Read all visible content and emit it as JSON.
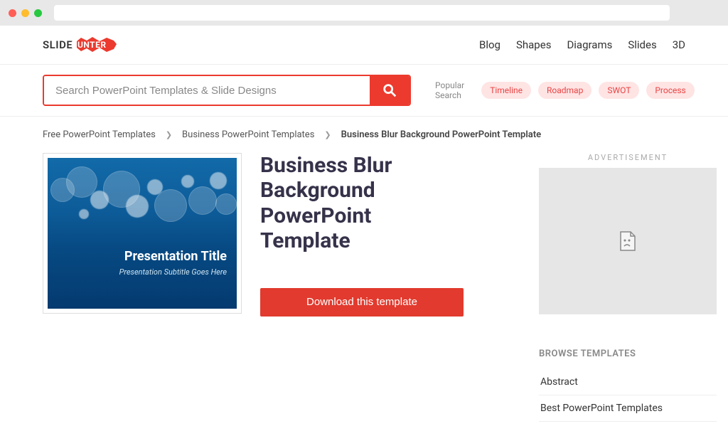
{
  "logo": {
    "pre": "SLIDE",
    "post": "HUNTER"
  },
  "nav": {
    "blog": "Blog",
    "shapes": "Shapes",
    "diagrams": "Diagrams",
    "slides": "Slides",
    "threeD": "3D"
  },
  "search": {
    "placeholder": "Search PowerPoint Templates & Slide Designs",
    "popular_label": "Popular Search"
  },
  "pills": {
    "timeline": "Timeline",
    "roadmap": "Roadmap",
    "swot": "SWOT",
    "process": "Process"
  },
  "crumbs": {
    "c1": "Free PowerPoint Templates",
    "c2": "Business PowerPoint Templates",
    "current": "Business Blur Background PowerPoint Template"
  },
  "preview": {
    "title": "Presentation Title",
    "subtitle": "Presentation Subtitle Goes Here"
  },
  "page": {
    "title": "Business Blur Background PowerPoint Template",
    "download": "Download this template"
  },
  "sidebar": {
    "ad_label": "ADVERTISEMENT",
    "browse_label": "BROWSE TEMPLATES",
    "cat1": "Abstract",
    "cat2": "Best PowerPoint Templates"
  }
}
